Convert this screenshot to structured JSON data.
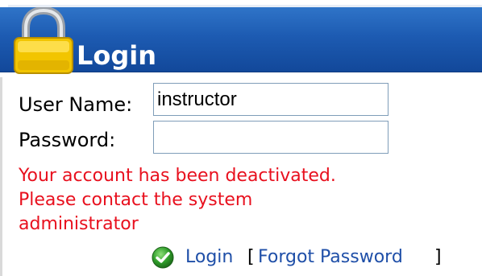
{
  "header": {
    "title": "Login",
    "icon": "padlock-icon"
  },
  "form": {
    "username_label": "User Name:",
    "username_value": "instructor",
    "password_label": "Password:",
    "password_value": ""
  },
  "error": {
    "lines": [
      "Your account has been deactivated.",
      "Please contact the system",
      "administrator"
    ]
  },
  "actions": {
    "login_label": "Login",
    "login_icon": "green-check-icon",
    "bracket_open": "[",
    "forgot_label": "Forgot Password",
    "bracket_close": "]"
  },
  "colors": {
    "header_bg": "#1d5bb2",
    "error_text": "#e8101e",
    "link_text": "#1f4fa8"
  }
}
